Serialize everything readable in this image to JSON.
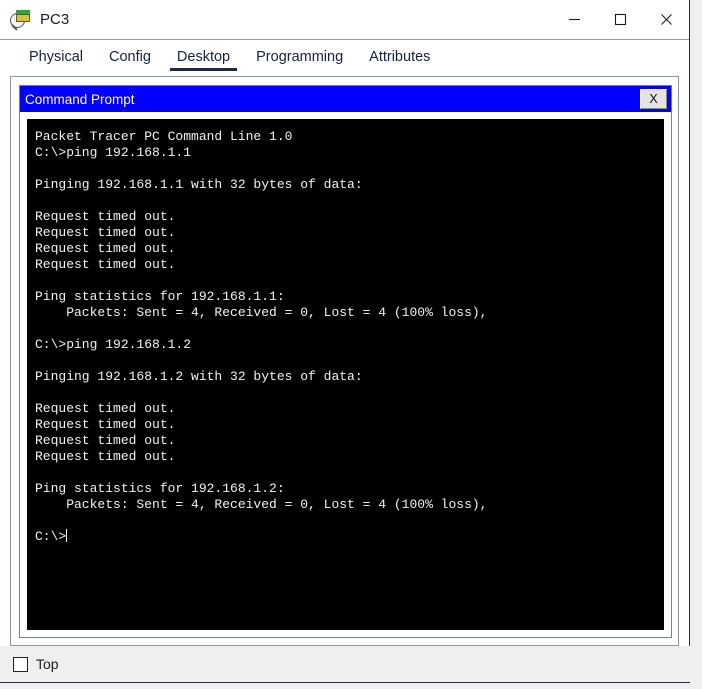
{
  "window": {
    "title": "PC3",
    "icon": "packet-tracer-icon",
    "controls": {
      "minimize_label": "Minimize",
      "maximize_label": "Maximize",
      "close_label": "Close"
    }
  },
  "tabs": [
    {
      "label": "Physical",
      "selected": false
    },
    {
      "label": "Config",
      "selected": false
    },
    {
      "label": "Desktop",
      "selected": true
    },
    {
      "label": "Programming",
      "selected": false
    },
    {
      "label": "Attributes",
      "selected": false
    }
  ],
  "command_prompt": {
    "title": "Command Prompt",
    "close_label": "X",
    "titlebar_color": "#0000FF",
    "background_color": "#000000",
    "text_color": "#F2F2F2",
    "output": "Packet Tracer PC Command Line 1.0\nC:\\>ping 192.168.1.1\n\nPinging 192.168.1.1 with 32 bytes of data:\n\nRequest timed out.\nRequest timed out.\nRequest timed out.\nRequest timed out.\n\nPing statistics for 192.168.1.1:\n    Packets: Sent = 4, Received = 0, Lost = 4 (100% loss),\n\nC:\\>ping 192.168.1.2\n\nPinging 192.168.1.2 with 32 bytes of data:\n\nRequest timed out.\nRequest timed out.\nRequest timed out.\nRequest timed out.\n\nPing statistics for 192.168.1.2:\n    Packets: Sent = 4, Received = 0, Lost = 4 (100% loss),\n\nC:\\>"
  },
  "bottom": {
    "top_checkbox_label": "Top",
    "top_checkbox_checked": false
  }
}
